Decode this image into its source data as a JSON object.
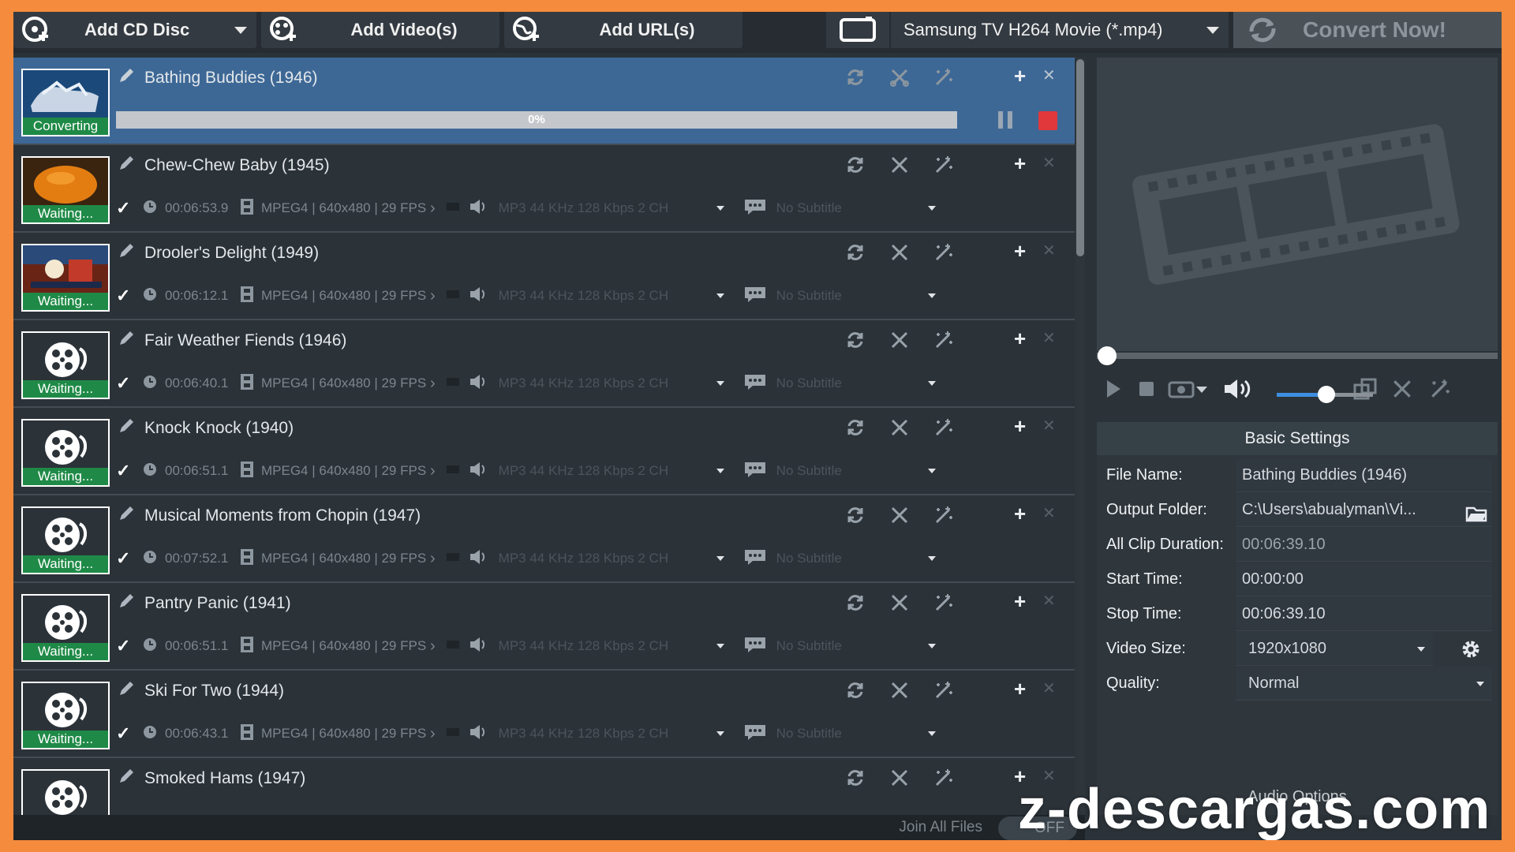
{
  "toolbar": {
    "add_cd": "Add CD Disc",
    "add_video": "Add Video(s)",
    "add_url": "Add URL(s)",
    "output_format": "Samsung TV H264 Movie (*.mp4)",
    "convert": "Convert Now!"
  },
  "active_item": {
    "title": "Bathing Buddies (1946)",
    "status": "Converting",
    "progress_text": "0%",
    "progress": 0
  },
  "items": [
    {
      "title": "Chew-Chew Baby (1945)",
      "status": "Waiting...",
      "duration": "00:06:53.9",
      "video": "MPEG4 | 640x480 | 29 FPS",
      "audio": "MP3 44 KHz 128 Kbps 2 CH",
      "subtitle": "No Subtitle"
    },
    {
      "title": "Drooler's Delight (1949)",
      "status": "Waiting...",
      "duration": "00:06:12.1",
      "video": "MPEG4 | 640x480 | 29 FPS",
      "audio": "MP3 44 KHz 128 Kbps 2 CH",
      "subtitle": "No Subtitle"
    },
    {
      "title": "Fair Weather Fiends (1946)",
      "status": "Waiting...",
      "duration": "00:06:40.1",
      "video": "MPEG4 | 640x480 | 29 FPS",
      "audio": "MP3 44 KHz 128 Kbps 2 CH",
      "subtitle": "No Subtitle"
    },
    {
      "title": "Knock Knock (1940)",
      "status": "Waiting...",
      "duration": "00:06:51.1",
      "video": "MPEG4 | 640x480 | 29 FPS",
      "audio": "MP3 44 KHz 128 Kbps 2 CH",
      "subtitle": "No Subtitle"
    },
    {
      "title": "Musical Moments from Chopin (1947)",
      "status": "Waiting...",
      "duration": "00:07:52.1",
      "video": "MPEG4 | 640x480 | 29 FPS",
      "audio": "MP3 44 KHz 128 Kbps 2 CH",
      "subtitle": "No Subtitle"
    },
    {
      "title": "Pantry Panic (1941)",
      "status": "Waiting...",
      "duration": "00:06:51.1",
      "video": "MPEG4 | 640x480 | 29 FPS",
      "audio": "MP3 44 KHz 128 Kbps 2 CH",
      "subtitle": "No Subtitle"
    },
    {
      "title": "Ski For Two (1944)",
      "status": "Waiting...",
      "duration": "00:06:43.1",
      "video": "MPEG4 | 640x480 | 29 FPS",
      "audio": "MP3 44 KHz 128 Kbps 2 CH",
      "subtitle": "No Subtitle"
    },
    {
      "title": "Smoked Hams (1947)",
      "status": "",
      "duration": "",
      "video": "",
      "audio": "",
      "subtitle": ""
    }
  ],
  "bottom": {
    "join_label": "Join All Files",
    "toggle": "OFF"
  },
  "settings": {
    "title": "Basic Settings",
    "file_name_label": "File Name:",
    "file_name": "Bathing Buddies (1946)",
    "output_folder_label": "Output Folder:",
    "output_folder": "C:\\Users\\abualyman\\Vi...",
    "duration_label": "All Clip Duration:",
    "duration": "00:06:39.10",
    "start_label": "Start Time:",
    "start": "00:00:00",
    "stop_label": "Stop Time:",
    "stop": "00:06:39.10",
    "size_label": "Video Size:",
    "size": "1920x1080",
    "quality_label": "Quality:",
    "quality": "Normal",
    "audio_options": "Audio Options"
  },
  "player": {
    "seek_position": 0,
    "volume": 0.5
  },
  "watermark": "z-descargas.com",
  "colors": {
    "frame": "#f58b3c",
    "active_row": "#3d6896",
    "status_green": "#1f8a47",
    "stop_red": "#e0383b",
    "volume_blue": "#3e8fe0"
  }
}
